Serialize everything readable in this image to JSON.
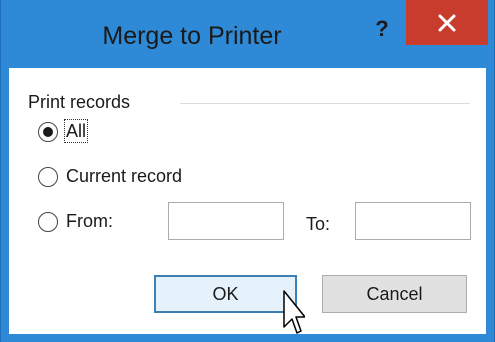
{
  "dialog": {
    "title": "Merge to Printer",
    "help_label": "?"
  },
  "group": {
    "label": "Print records"
  },
  "options": {
    "all": "All",
    "current_record": "Current record",
    "from": "From:",
    "to": "To:",
    "selected": "all"
  },
  "fields": {
    "from_value": "",
    "to_value": ""
  },
  "buttons": {
    "ok": "OK",
    "cancel": "Cancel"
  },
  "colors": {
    "title_bar": "#2e8ad6",
    "close_button": "#c83c2e"
  }
}
